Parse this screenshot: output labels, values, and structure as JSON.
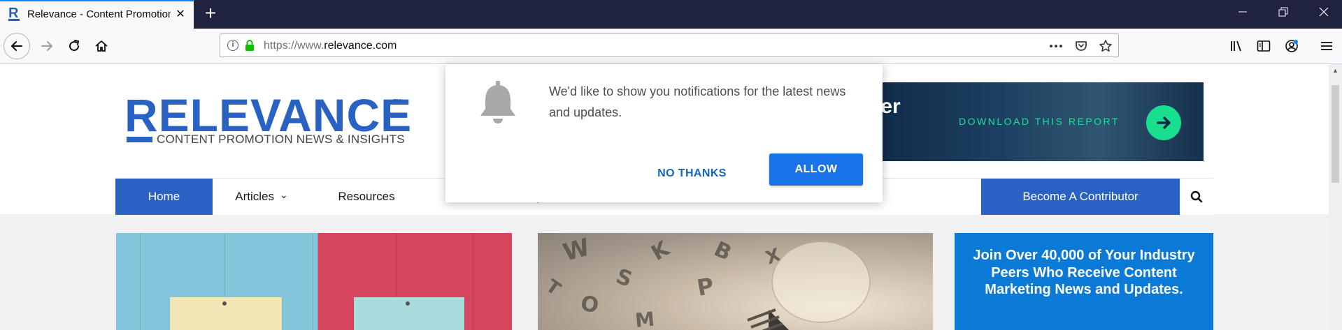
{
  "tab": {
    "title": "Relevance - Content Promotion News & Insights",
    "favicon_letter": "R",
    "close_glyph": "✕",
    "new_tab_glyph": "+"
  },
  "window_controls": {
    "minimize_glyph": "—",
    "restore_glyph": "❐",
    "close_glyph": "✕"
  },
  "urlbar": {
    "prefix": "https://www.",
    "domain": "relevance.com",
    "info_glyph": "i"
  },
  "site": {
    "logo_word": "RELEVANCE",
    "logo_tm": "™",
    "logo_sub": "CONTENT PROMOTION NEWS & INSIGHTS",
    "ad_partial_text": "her",
    "ad_cta": "DOWNLOAD THIS REPORT",
    "nav": {
      "home": "Home",
      "articles": "Articles",
      "articles_chevron": "⌄",
      "resources": "Resources",
      "partial_item": "y",
      "contributor": "Become A Contributor"
    },
    "join_text": "Join Over 40,000 of Your Industry Peers Who Receive Content Marketing News and Updates."
  },
  "popup": {
    "message": "We'd like to show you notifications for the latest news and updates.",
    "no_label": "NO THANKS",
    "allow_label": "ALLOW"
  },
  "scrollbar": {
    "up_glyph": "▲"
  },
  "colors": {
    "brand_blue": "#2a62c4",
    "allow_blue": "#1a73e8",
    "ad_green": "#19e08f",
    "tabstrip": "#202340",
    "join_blue": "#0b7ad6"
  },
  "icons": [
    "back-arrow-icon",
    "forward-arrow-icon",
    "reload-icon",
    "home-icon",
    "info-icon",
    "lock-icon",
    "more-actions-icon",
    "pocket-icon",
    "bookmark-star-icon",
    "library-icon",
    "sidebar-icon",
    "account-icon",
    "menu-icon",
    "bell-icon",
    "search-icon",
    "arrow-right-icon"
  ]
}
